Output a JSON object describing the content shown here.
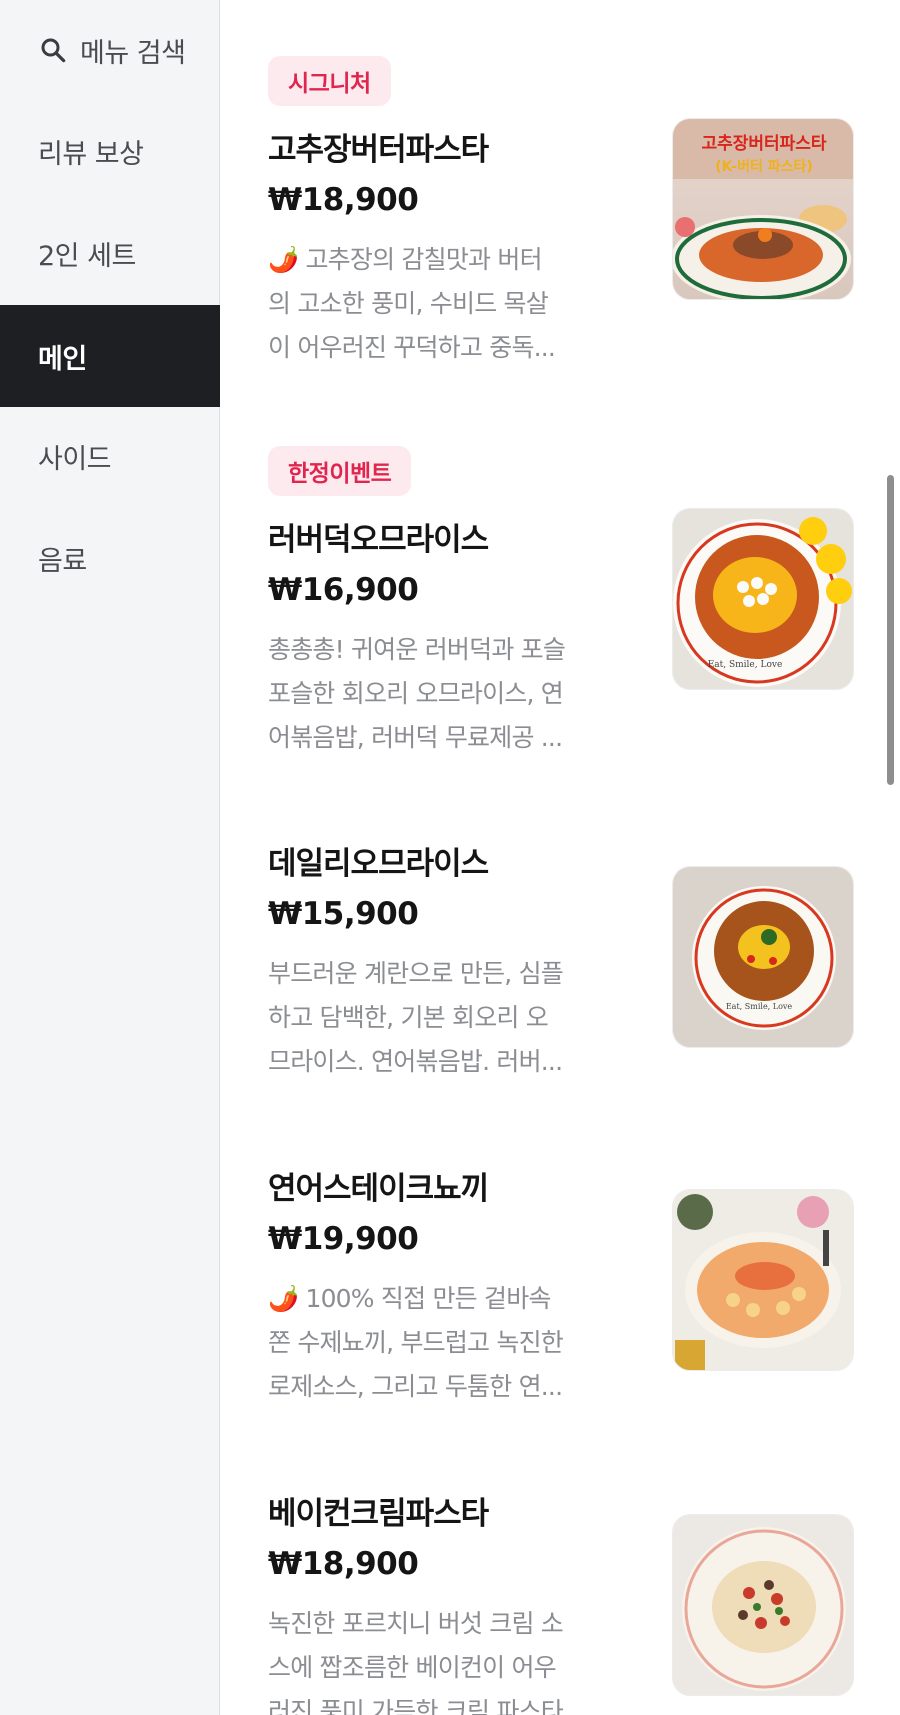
{
  "sidebar": {
    "search_label": "메뉴 검색",
    "categories": [
      {
        "label": "리뷰 보상"
      },
      {
        "label": "2인 세트"
      },
      {
        "label": "메인"
      },
      {
        "label": "사이드"
      },
      {
        "label": "음료"
      }
    ],
    "active_category": "메인"
  },
  "items": [
    {
      "badge": "시그니처",
      "name": "고추장버터파스타",
      "price": "₩18,900",
      "desc": [
        "🌶️ 고추장의 감칠맛과 버터",
        "의 고소한 풍미, 수비드 목살",
        "이 어우러진 꾸덕하고 중독..."
      ],
      "thumb_text": [
        "고추장버터파스타",
        "(K-버터 파스타)"
      ]
    },
    {
      "badge": "한정이벤트",
      "name": "러버덕오므라이스",
      "price": "₩16,900",
      "desc": [
        "총총총! 귀여운 러버덕과 포슬",
        "포슬한 회오리 오므라이스, 연",
        "어볶음밥, 러버덕 무료제공 ..."
      ],
      "thumb_text": [
        "Eat, Smile, Love"
      ]
    },
    {
      "name": "데일리오므라이스",
      "price": "₩15,900",
      "desc": [
        "부드러운 계란으로 만든, 심플",
        "하고 담백한, 기본 회오리 오",
        "므라이스. 연어볶음밥. 러버..."
      ],
      "thumb_text": [
        "Eat, Smile, Love"
      ]
    },
    {
      "name": "연어스테이크뇨끼",
      "price": "₩19,900",
      "desc": [
        "🌶️ 100% 직접 만든 겉바속",
        "쫀 수제뇨끼, 부드럽고 녹진한",
        "로제소스, 그리고 두툼한 연..."
      ]
    },
    {
      "name": "베이컨크림파스타",
      "price": "₩18,900",
      "desc": [
        "녹진한 포르치니 버섯 크림 소",
        "스에 짭조름한 베이컨이 어우",
        "러진 풍미 가득한 크림 파스타"
      ]
    }
  ],
  "colors": {
    "badge_text": "#e0264f",
    "badge_bg": "#fdeaee",
    "active_bg": "#1e1f22",
    "sidebar_bg": "#f4f5f7"
  }
}
